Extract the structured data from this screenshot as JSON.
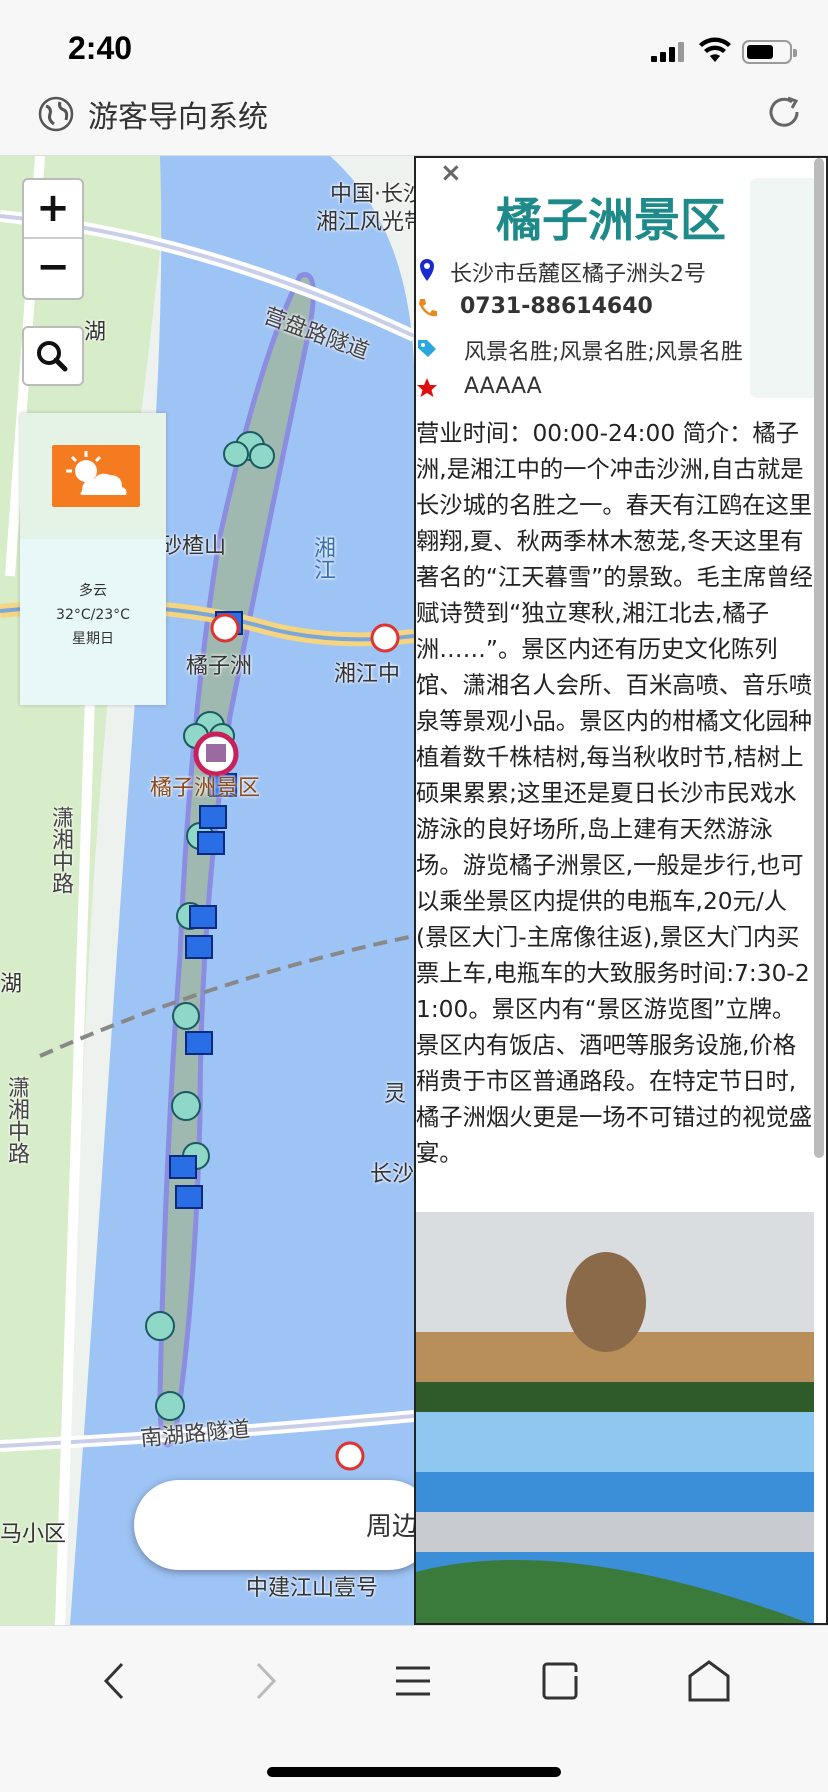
{
  "status_bar": {
    "time": "2:40"
  },
  "app": {
    "title": "游客导向系统"
  },
  "map": {
    "zoom_in": "+",
    "zoom_out": "−",
    "labels": {
      "top_right_1": "中国·长沙",
      "top_right_2": "湘江风光带",
      "tunnel_1": "营盘路隧道",
      "left_lake_1": "湖",
      "river": "湘江",
      "island_north": "砂楂山",
      "island_station": "橘子洲",
      "xiangjiang_zhong": "湘江中",
      "scenic_area": "橘子洲景区",
      "road_left": "潇湘中路",
      "left_lake_2": "湖",
      "road_left_2": "潇湘中路",
      "ling": "灵",
      "changsha": "长沙",
      "tunnel_2": "南湖路隧道",
      "bottom_left": "马小区",
      "bottom_center": "中建江山壹号"
    },
    "nearby_button": "周边"
  },
  "weather": {
    "condition": "多云",
    "temperature": "32°C/23°C",
    "weekday": "星期日"
  },
  "info_panel": {
    "close": "×",
    "name": "橘子洲景区",
    "address": "长沙市岳麓区橘子洲头2号",
    "phone": "0731-88614640",
    "tags": "风景名胜;风景名胜;风景名胜",
    "rating": "AAAAA",
    "description": "营业时间：00:00-24:00 简介：橘子洲,是湘江中的一个冲击沙洲,自古就是长沙城的名胜之一。春天有江鸥在这里翱翔,夏、秋两季林木葱茏,冬天这里有著名的“江天暮雪”的景致。毛主席曾经赋诗赞到“独立寒秋,湘江北去,橘子洲……”。景区内还有历史文化陈列馆、潇湘名人会所、百米高喷、音乐喷泉等景观小品。景区内的柑橘文化园种植着数千株桔树,每当秋收时节,桔树上硕果累累;这里还是夏日长沙市民戏水游泳的良好场所,岛上建有天然游泳场。游览橘子洲景区,一般是步行,也可以乘坐景区内提供的电瓶车,20元/人(景区大门-主席像往返),景区大门内买票上车,电瓶车的大致服务时间:7:30-21:00。景区内有“景区游览图”立牌。景区内有饭店、酒吧等服务设施,价格稍贵于市区普通路段。在特定节日时,橘子洲烟火更是一场不可错过的视觉盛宴。"
  },
  "colors": {
    "accent_title": "#1f8a8a",
    "river": "#9ec3f5",
    "island": "#9fb8b0",
    "weather_icon": "#f47b20"
  }
}
